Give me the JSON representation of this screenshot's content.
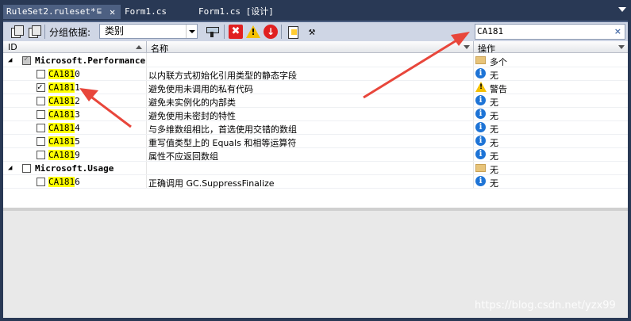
{
  "tabs": [
    {
      "label": "RuleSet2.ruleset*",
      "pin": "⊑",
      "close": "✕"
    },
    {
      "label": "Form1.cs"
    },
    {
      "label": "Form1.cs [设计]"
    }
  ],
  "toolbar": {
    "group_label": "分组依据:",
    "group_value": "类别",
    "err_glyph": "✖",
    "warn_glyph": "!",
    "info_glyph": "↓",
    "wrench_glyph": "⚒",
    "search_value": "CA181",
    "search_clear": "×"
  },
  "columns": {
    "id": "ID",
    "name": "名称",
    "action": "操作"
  },
  "search_highlight": "CA181",
  "groups": [
    {
      "label": "Microsoft.Performance",
      "expander": "◢",
      "action": "多个",
      "rules": [
        {
          "id_hl": "CA181",
          "id_rest": "0",
          "name": "以内联方式初始化引用类型的静态字段",
          "action": "无",
          "icon": "info",
          "checked": false
        },
        {
          "id_hl": "CA181",
          "id_rest": "1",
          "name": "避免使用未调用的私有代码",
          "action": "警告",
          "icon": "warn",
          "checked": true
        },
        {
          "id_hl": "CA181",
          "id_rest": "2",
          "name": "避免未实例化的内部类",
          "action": "无",
          "icon": "info",
          "checked": false
        },
        {
          "id_hl": "CA181",
          "id_rest": "3",
          "name": "避免使用未密封的特性",
          "action": "无",
          "icon": "info",
          "checked": false
        },
        {
          "id_hl": "CA181",
          "id_rest": "4",
          "name": "与多维数组相比，首选使用交错的数组",
          "action": "无",
          "icon": "info",
          "checked": false
        },
        {
          "id_hl": "CA181",
          "id_rest": "5",
          "name": "重写值类型上的 Equals 和相等运算符",
          "action": "无",
          "icon": "info",
          "checked": false
        },
        {
          "id_hl": "CA181",
          "id_rest": "9",
          "name": "属性不应返回数组",
          "action": "无",
          "icon": "info",
          "checked": false
        }
      ]
    },
    {
      "label": "Microsoft.Usage",
      "expander": "◢",
      "action": "无",
      "rules": [
        {
          "id_hl": "CA181",
          "id_rest": "6",
          "name": "正确调用 GC.SuppressFinalize",
          "action": "无",
          "icon": "info",
          "checked": false
        }
      ]
    }
  ],
  "icon_glyphs": {
    "info": "i",
    "warn": "!"
  },
  "watermark": "https://blog.csdn.net/yzx99",
  "colors": {
    "accent": "#4d6082",
    "highlight": "#ffff00",
    "arrow": "#e8463b",
    "info": "#1e74d6"
  }
}
